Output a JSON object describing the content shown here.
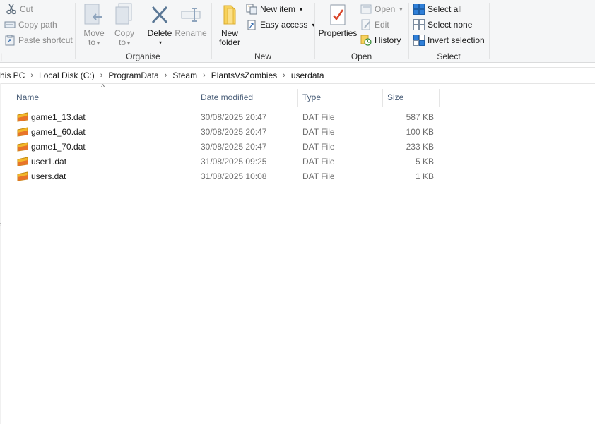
{
  "ribbon": {
    "clipboard": {
      "cut": "Cut",
      "copy_path": "Copy path",
      "paste_shortcut": "Paste shortcut"
    },
    "organise": {
      "label": "Organise",
      "move_to": [
        "Move",
        "to"
      ],
      "copy_to": [
        "Copy",
        "to"
      ],
      "delete": "Delete",
      "rename": "Rename"
    },
    "new": {
      "label": "New",
      "new_folder": [
        "New",
        "folder"
      ],
      "new_item": "New item",
      "easy_access": "Easy access"
    },
    "open": {
      "label": "Open",
      "properties": "Properties",
      "open": "Open",
      "edit": "Edit",
      "history": "History"
    },
    "select": {
      "label": "Select",
      "select_all": "Select all",
      "select_none": "Select none",
      "invert": "Invert selection"
    }
  },
  "address": {
    "crumbs": [
      "his PC",
      "Local Disk (C:)",
      "ProgramData",
      "Steam",
      "PlantsVsZombies",
      "userdata"
    ]
  },
  "columns": {
    "name": "Name",
    "date": "Date modified",
    "type": "Type",
    "size": "Size",
    "sort_indicator": "^"
  },
  "files": [
    {
      "name": "game1_13.dat",
      "date": "30/08/2025 20:47",
      "type": "DAT File",
      "size": "587 KB"
    },
    {
      "name": "game1_60.dat",
      "date": "30/08/2025 20:47",
      "type": "DAT File",
      "size": "100 KB"
    },
    {
      "name": "game1_70.dat",
      "date": "30/08/2025 20:47",
      "type": "DAT File",
      "size": "233 KB"
    },
    {
      "name": "user1.dat",
      "date": "31/08/2025 09:25",
      "type": "DAT File",
      "size": "5 KB"
    },
    {
      "name": "users.dat",
      "date": "31/08/2025 10:08",
      "type": "DAT File",
      "size": "1 KB"
    }
  ],
  "colors": {
    "accent": "#1e78d6",
    "header_text": "#4c607a",
    "ribbon_bg": "#f5f6f7"
  }
}
